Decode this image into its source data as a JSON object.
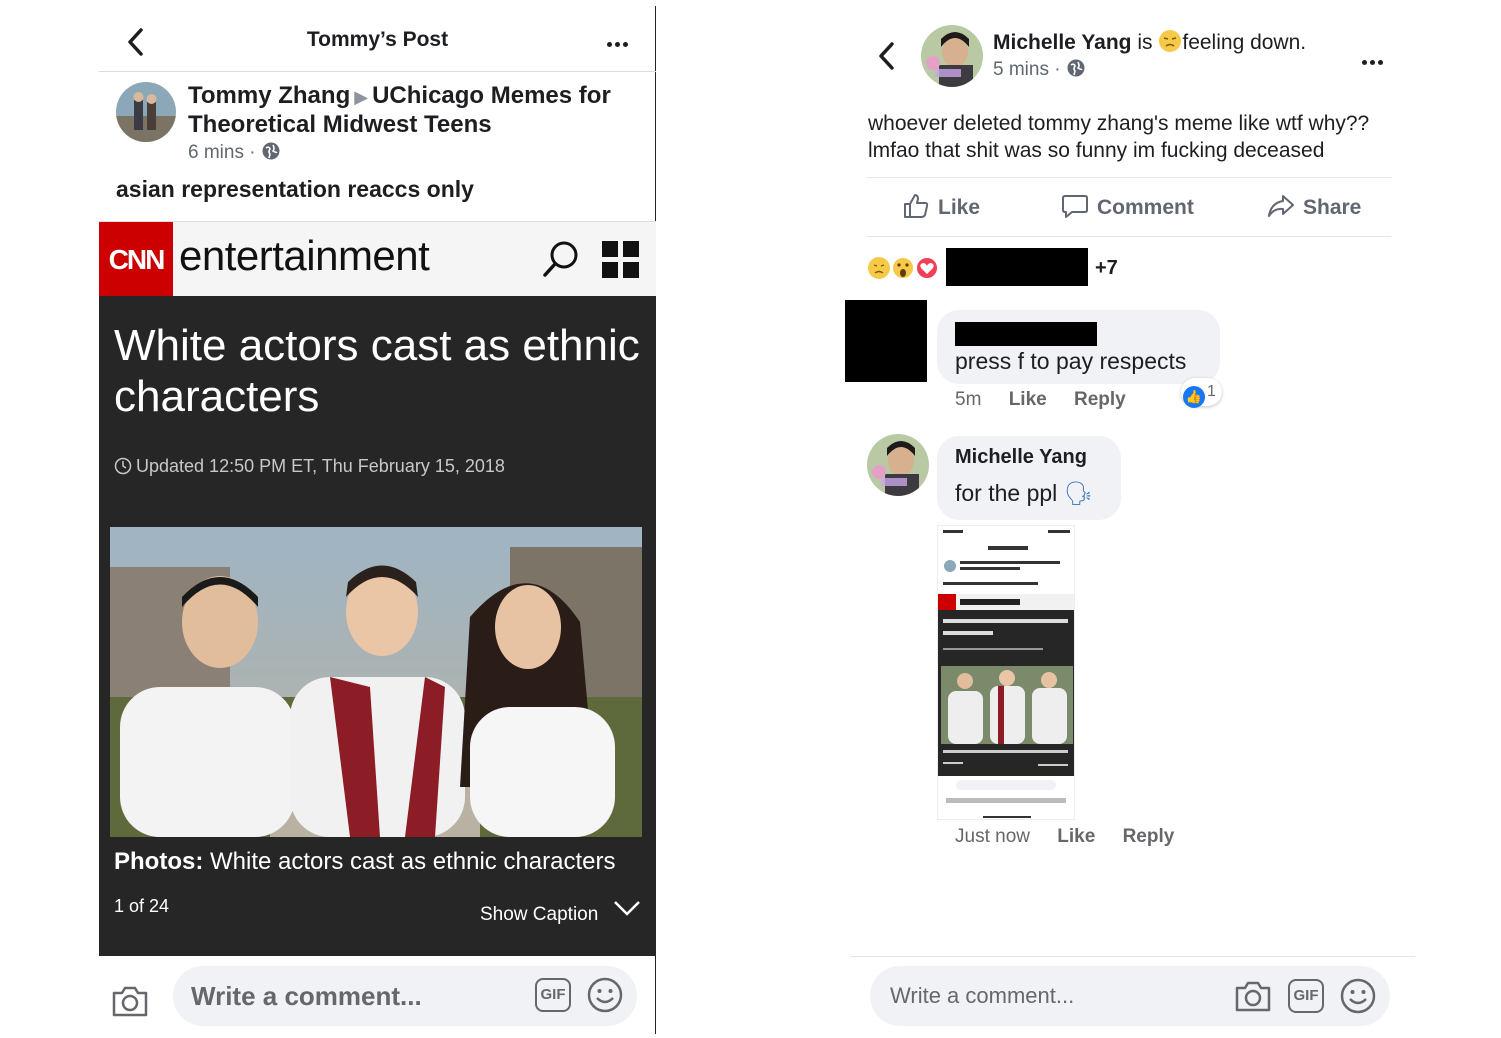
{
  "left_post": {
    "header_title": "Tommy’s Post",
    "author": "Tommy Zhang",
    "group": "UChicago Memes for Theoretical Midwest Teens",
    "time": "6 mins ·",
    "message": "asian representation reaccs only",
    "cnn": {
      "logo": "CNN",
      "section": "entertainment",
      "headline": "White actors cast as ethnic characters",
      "updated": "Updated 12:50 PM ET, Thu February 15, 2018",
      "caption_label": "Photos:",
      "caption": "White actors cast as ethnic characters",
      "count": "1 of 24",
      "show_caption": "Show Caption"
    },
    "composer_placeholder": "Write a comment...",
    "gif_label": "GIF"
  },
  "right_post": {
    "author": "Michelle Yang",
    "is": "is",
    "feeling": "feeling down.",
    "time": "5 mins ·",
    "message": "whoever deleted tommy zhang's meme like wtf why?? lmfao that shit was so funny im fucking deceased",
    "actions": {
      "like": "Like",
      "comment": "Comment",
      "share": "Share"
    },
    "reactions_more": "+7",
    "comments": [
      {
        "text": "press f to pay respects",
        "time": "5m",
        "like": "Like",
        "reply": "Reply",
        "like_count": "1"
      },
      {
        "author": "Michelle Yang",
        "text": "for the ppl",
        "emoji": "🗣",
        "time": "Just now",
        "like": "Like",
        "reply": "Reply"
      }
    ],
    "composer_placeholder": "Write a comment...",
    "gif_label": "GIF"
  },
  "colors": {
    "cnn_red": "#cc0000",
    "facebook_blue": "#1877f2",
    "dark_bg": "#262626"
  }
}
